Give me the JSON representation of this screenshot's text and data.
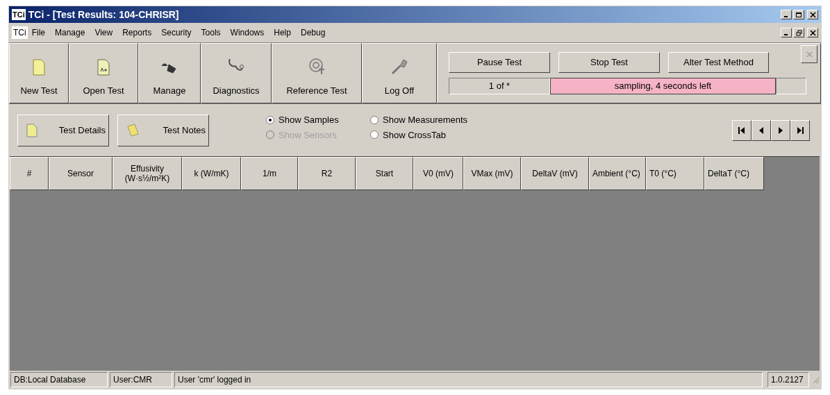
{
  "window": {
    "app_icon": "TCi",
    "title": "TCi - [Test Results: 104-CHRISR]"
  },
  "menu_bar": {
    "app_icon": "TCi",
    "items": [
      "File",
      "Manage",
      "View",
      "Reports",
      "Security",
      "Tools",
      "Windows",
      "Help",
      "Debug"
    ]
  },
  "toolbar": [
    {
      "label": "New Test",
      "kind": "new"
    },
    {
      "label": "Open Test",
      "kind": "open"
    },
    {
      "label": "Manage",
      "kind": "manage"
    },
    {
      "label": "Diagnostics",
      "kind": "diagnostics"
    },
    {
      "label": "Reference Test",
      "kind": "reference"
    },
    {
      "label": "Log Off",
      "kind": "logoff"
    }
  ],
  "test_controls": {
    "buttons": [
      "Pause Test",
      "Stop Test",
      "Alter Test Method"
    ],
    "counter": "1 of *",
    "status": "sampling, 4 seconds left"
  },
  "view_bar": {
    "buttons": [
      {
        "label": "Test Details",
        "kind": "details"
      },
      {
        "label": "Test Notes",
        "kind": "notes"
      }
    ],
    "options": [
      {
        "label": "Show Samples",
        "selected": true,
        "disabled": false
      },
      {
        "label": "Show Measurements",
        "selected": false,
        "disabled": false
      },
      {
        "label": "Show Sensors",
        "selected": false,
        "disabled": true
      },
      {
        "label": "Show CrossTab",
        "selected": false,
        "disabled": false
      }
    ]
  },
  "table": {
    "columns": [
      "#",
      "Sensor",
      "Effusivity (W·s½/m²K)",
      "k (W/mK)",
      "1/m",
      "R2",
      "Start",
      "V0 (mV)",
      "VMax (mV)",
      "DeltaV (mV)",
      "Ambient (°C)",
      "T0 (°C)",
      "DeltaT (°C)"
    ]
  },
  "status_bar": [
    "DB:Local Database",
    "User:CMR",
    "User 'cmr' logged in",
    "1.0.2127"
  ]
}
